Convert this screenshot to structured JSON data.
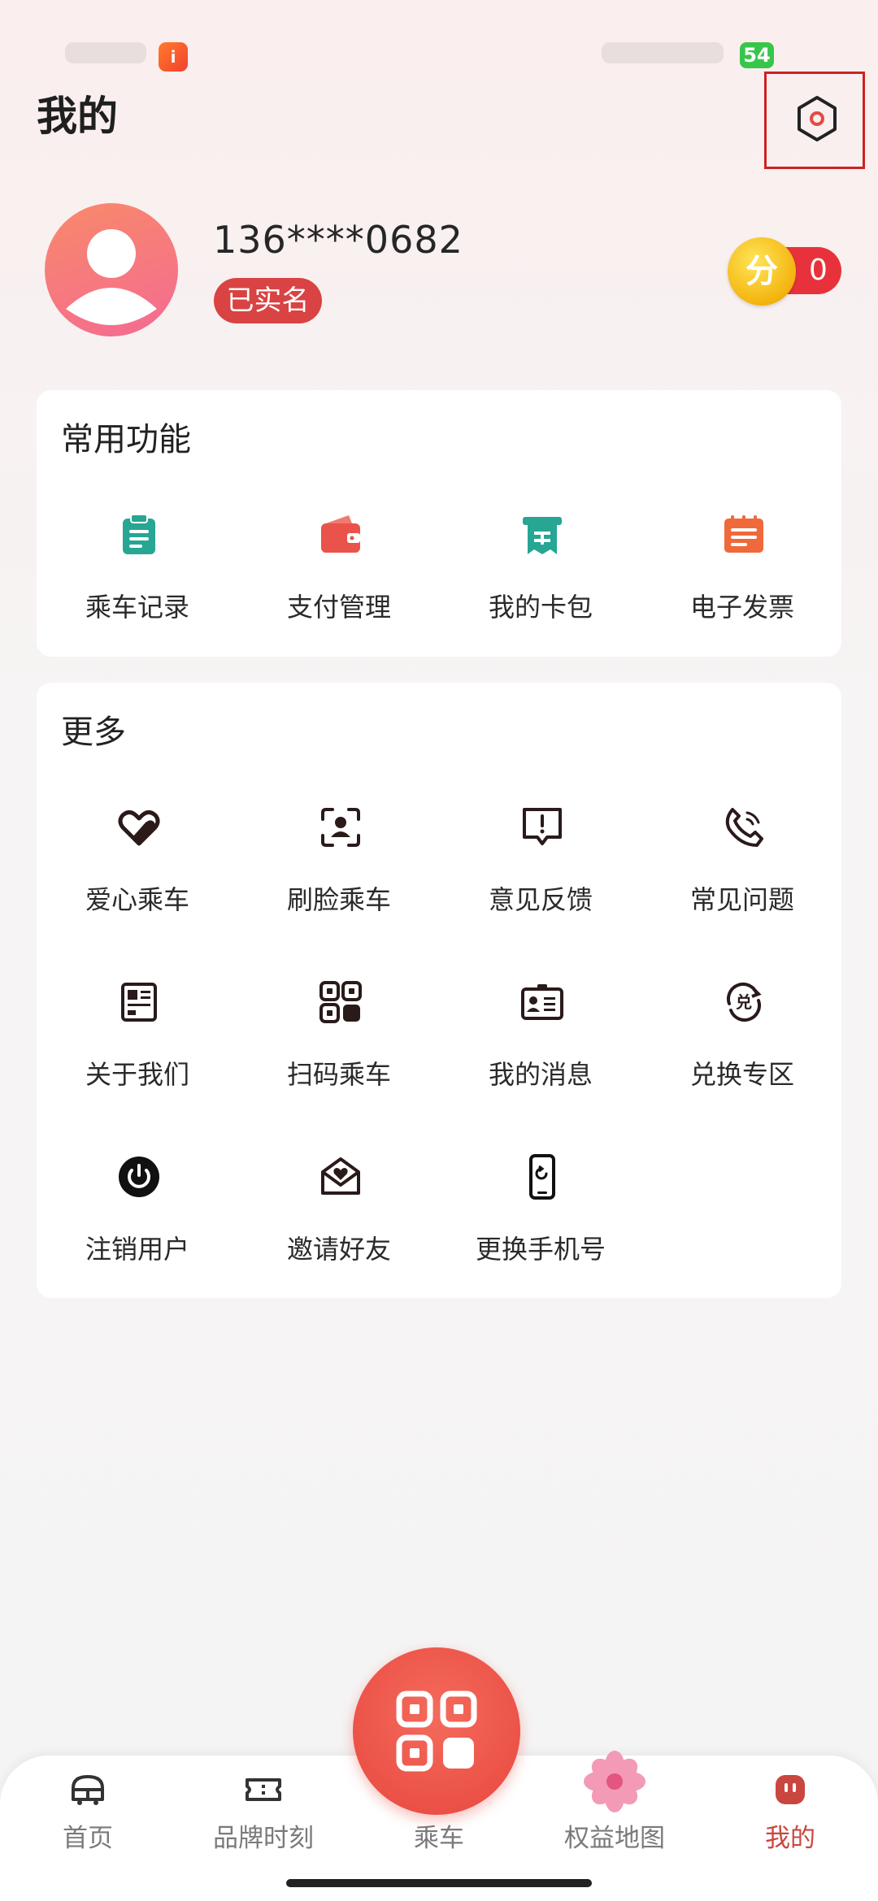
{
  "status_bar": {
    "app_badge": "i",
    "battery": "54"
  },
  "header": {
    "title": "我的"
  },
  "profile": {
    "phone": "136****0682",
    "verified_label": "已实名"
  },
  "points": {
    "coin_label": "分",
    "value": "0"
  },
  "common_functions": {
    "title": "常用功能",
    "items": [
      {
        "label": "乘车记录",
        "icon": "clipboard-icon",
        "color": "#26a693"
      },
      {
        "label": "支付管理",
        "icon": "wallet-icon",
        "color": "#e9534b"
      },
      {
        "label": "我的卡包",
        "icon": "card-pack-icon",
        "color": "#26a693"
      },
      {
        "label": "电子发票",
        "icon": "invoice-icon",
        "color": "#f0693a"
      }
    ]
  },
  "more": {
    "title": "更多",
    "items": [
      {
        "label": "爱心乘车",
        "icon": "heart-icon"
      },
      {
        "label": "刷脸乘车",
        "icon": "face-scan-icon"
      },
      {
        "label": "意见反馈",
        "icon": "feedback-icon"
      },
      {
        "label": "常见问题",
        "icon": "phone-call-icon"
      },
      {
        "label": "关于我们",
        "icon": "about-icon"
      },
      {
        "label": "扫码乘车",
        "icon": "qr-code-icon"
      },
      {
        "label": "我的消息",
        "icon": "message-icon"
      },
      {
        "label": "兑换专区",
        "icon": "exchange-icon"
      },
      {
        "label": "注销用户",
        "icon": "power-icon"
      },
      {
        "label": "邀请好友",
        "icon": "invite-icon"
      },
      {
        "label": "更换手机号",
        "icon": "change-phone-icon"
      }
    ]
  },
  "tabbar": {
    "tabs": [
      {
        "label": "首页",
        "icon": "bus-icon"
      },
      {
        "label": "品牌时刻",
        "icon": "ticket-icon"
      },
      {
        "label": "乘车",
        "icon": "scan-icon"
      },
      {
        "label": "权益地图",
        "icon": "flower-icon"
      },
      {
        "label": "我的",
        "icon": "profile-icon",
        "active": true
      }
    ],
    "active_color": "#c9473f"
  }
}
